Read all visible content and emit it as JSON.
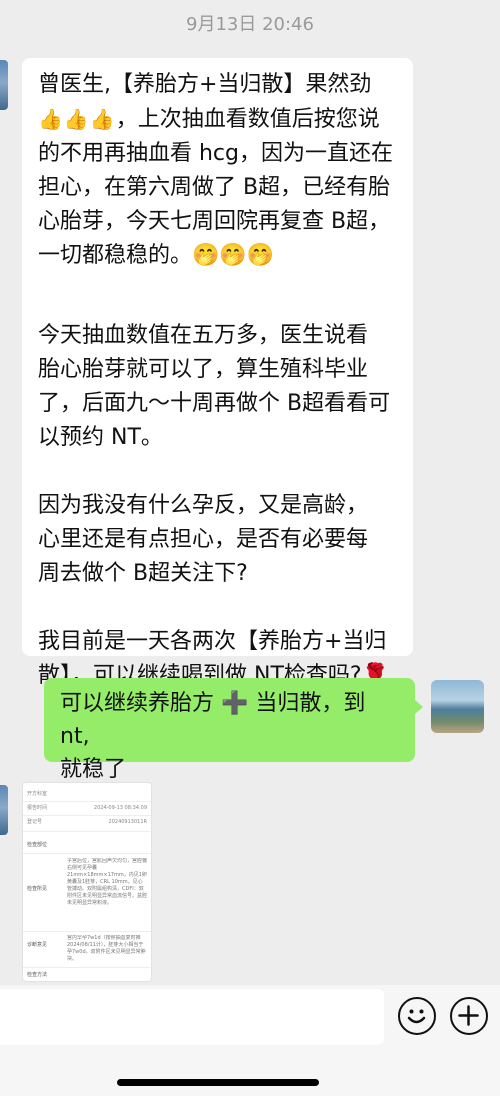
{
  "chat": {
    "timestamp": "9月13日 20:46",
    "incoming_message": {
      "line1": "曾医生,【养胎方+当归散】果然劲",
      "thumbs": "👍👍👍",
      "line2": "，上次抽血看数值后按您说",
      "line3": "的不用再抽血看 hcg，因为一直还在",
      "line4": "担心，在第六周做了 B超，已经有胎",
      "line5": "心胎芽，今天七周回院再复查 B超，",
      "line6": "一切都稳稳的。🤭🤭🤭",
      "para2": "今天抽血数值在五万多，医生说看\n胎心胎芽就可以了，算生殖科毕业\n了，后面九～十周再做个 B超看看可\n以预约 NT。",
      "para3": "因为我没有什么孕反，又是高龄，\n心里还是有点担心，是否有必要每\n周去做个 B超关注下?",
      "para4": "我目前是一天各两次【养胎方+当归\n散】，可以继续喝到做 NT检查吗?🌹"
    },
    "outgoing_message": {
      "text": "可以继续养胎方 ➕ 当归散，到 nt,\n就稳了"
    },
    "report_image": {
      "rows": [
        {
          "key": "开方科室",
          "val": ""
        },
        {
          "key": "报告时间",
          "val": "2024-09-13 08:34:09"
        },
        {
          "key": "登记号",
          "val": "20240913011R"
        }
      ],
      "section_position": "检查部位",
      "section_findings": "检查所见",
      "findings_text": "子宫后位，宫肌回声欠均匀，宫腔偏右侧可见孕囊21mm×18mm×17mm，内见1卵黄囊及1胚芽，CRL 10mm，见心管搏动。双附属组构清，CDFI：双附件区未见明显异常血流信号。盆腔未见明显异常积液。",
      "section_diagnosis": "诊断意见",
      "diagnosis_text": "宫内早孕7w1d（按照抽血复时推2024/08/11计），胚芽大小相当于孕7w0d。双附件区未见明显异常肿块。",
      "section_method": "检查方法"
    }
  },
  "input_bar": {
    "emoji_icon": "smiley-icon",
    "plus_icon": "plus-icon"
  }
}
